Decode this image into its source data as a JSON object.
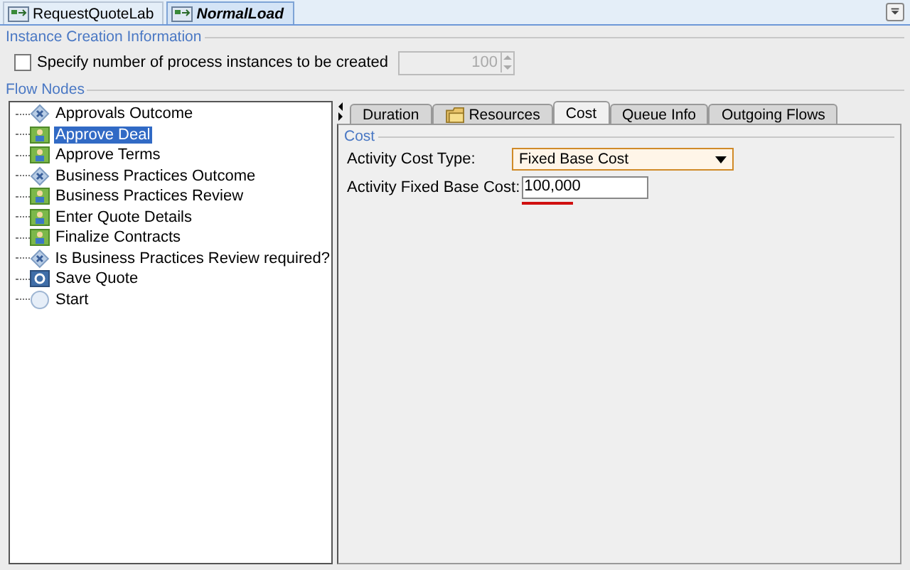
{
  "editor_tabs": [
    {
      "label": "RequestQuoteLab",
      "selected": false
    },
    {
      "label": "NormalLoad",
      "selected": true
    }
  ],
  "instance_creation": {
    "title": "Instance Creation Information",
    "checkbox_label": "Specify number of process instances to be created",
    "checked": false,
    "count": "100",
    "disabled": true
  },
  "flow_nodes": {
    "title": "Flow Nodes",
    "items": [
      {
        "label": "Approvals Outcome",
        "kind": "decision",
        "selected": false
      },
      {
        "label": "Approve Deal",
        "kind": "task",
        "selected": true
      },
      {
        "label": "Approve Terms",
        "kind": "task",
        "selected": false
      },
      {
        "label": "Business Practices Outcome",
        "kind": "decision",
        "selected": false
      },
      {
        "label": "Business Practices Review",
        "kind": "task",
        "selected": false
      },
      {
        "label": "Enter Quote Details",
        "kind": "task",
        "selected": false
      },
      {
        "label": "Finalize Contracts",
        "kind": "task",
        "selected": false
      },
      {
        "label": "Is Business Practices Review required?",
        "kind": "decision",
        "selected": false
      },
      {
        "label": "Save Quote",
        "kind": "service",
        "selected": false
      },
      {
        "label": "Start",
        "kind": "start",
        "selected": false
      }
    ]
  },
  "property_tabs": [
    {
      "label": "Duration",
      "selected": false,
      "icon": false
    },
    {
      "label": "Resources",
      "selected": false,
      "icon": true
    },
    {
      "label": "Cost",
      "selected": true,
      "icon": false
    },
    {
      "label": "Queue Info",
      "selected": false,
      "icon": false
    },
    {
      "label": "Outgoing Flows",
      "selected": false,
      "icon": false
    }
  ],
  "cost": {
    "title": "Cost",
    "type_label": "Activity Cost Type:",
    "type_value": "Fixed Base Cost",
    "base_label": "Activity Fixed Base Cost:",
    "base_value": "100,000"
  }
}
